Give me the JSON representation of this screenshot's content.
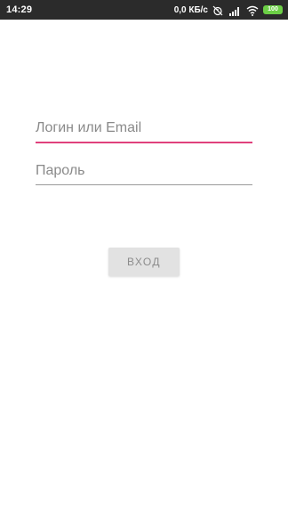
{
  "status_bar": {
    "time": "14:29",
    "network_speed": "0,0 КБ/с",
    "battery": "100",
    "icons": [
      "alarm-off-icon",
      "signal-icon",
      "wifi-icon",
      "battery-icon"
    ]
  },
  "login_form": {
    "login_placeholder": "Логин или Email",
    "password_placeholder": "Пароль",
    "submit_label": "ВХОД"
  },
  "colors": {
    "status_bar_bg": "#2b2b2b",
    "accent": "#e0417c",
    "button_bg": "#e2e2e2",
    "battery": "#6ccf46"
  }
}
